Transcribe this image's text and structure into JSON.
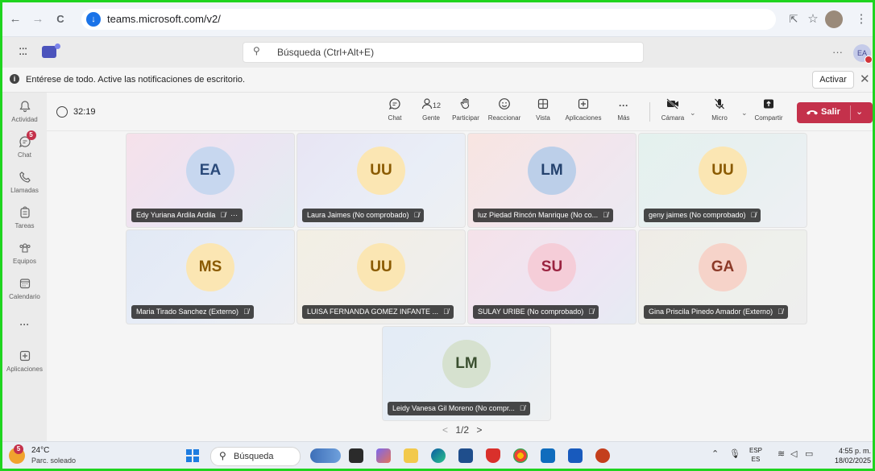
{
  "browser": {
    "url": "teams.microsoft.com/v2/",
    "back": "←",
    "forward": "→",
    "reload": "C",
    "cast": "⇱",
    "star": "☆",
    "menu": "⋮"
  },
  "teams_header": {
    "waffle": ":::",
    "search_placeholder": "Búsqueda (Ctrl+Alt+E)",
    "search_icon": "⚲",
    "more": "···",
    "user_initials": "EA"
  },
  "notification": {
    "message": "Entérese de todo. Active las notificaciones de escritorio.",
    "activate_label": "Activar",
    "close": "✕"
  },
  "rail": [
    {
      "label": "Actividad",
      "icon": "bell-icon",
      "glyph": "♫",
      "badge": ""
    },
    {
      "label": "Chat",
      "icon": "chat-icon",
      "glyph": "☺",
      "badge": "5"
    },
    {
      "label": "Llamadas",
      "icon": "phone-icon",
      "glyph": "☏",
      "badge": ""
    },
    {
      "label": "Tareas",
      "icon": "tasks-icon",
      "glyph": "⌂",
      "badge": ""
    },
    {
      "label": "Equipos",
      "icon": "teams-icon",
      "glyph": "⁂",
      "badge": ""
    },
    {
      "label": "Calendario",
      "icon": "calendar-icon",
      "glyph": "▦",
      "badge": ""
    },
    {
      "label": "",
      "icon": "more-icon",
      "glyph": "···",
      "badge": ""
    },
    {
      "label": "Aplicaciones",
      "icon": "apps-icon",
      "glyph": "⊞",
      "badge": ""
    }
  ],
  "meeting": {
    "timer": "32:19",
    "people_count": "12",
    "controls": {
      "chat": "Chat",
      "people": "Gente",
      "raise": "Participar",
      "react": "Reaccionar",
      "view": "Vista",
      "apps": "Aplicaciones",
      "more": "Más",
      "camera": "Cámara",
      "mic": "Micro",
      "share": "Compartir",
      "leave": "Salir"
    },
    "participants": [
      {
        "initials": "EA",
        "name": "Edy Yuriana Ardila Ardila",
        "extra": "···"
      },
      {
        "initials": "UU",
        "name": "Laura Jaimes (No comprobado)",
        "extra": ""
      },
      {
        "initials": "LM",
        "name": "luz Piedad Rincón Manrique (No co...",
        "extra": ""
      },
      {
        "initials": "UU",
        "name": "geny jaimes (No comprobado)",
        "extra": ""
      },
      {
        "initials": "MS",
        "name": "Maria Tirado Sanchez (Externo)",
        "extra": ""
      },
      {
        "initials": "UU",
        "name": "LUISA FERNANDA GOMEZ INFANTE ...",
        "extra": ""
      },
      {
        "initials": "SU",
        "name": "SULAY URIBE (No comprobado)",
        "extra": ""
      },
      {
        "initials": "GA",
        "name": "Gina Priscila Pinedo Amador (Externo)",
        "extra": ""
      },
      {
        "initials": "LM",
        "name": "Leidy Vanesa Gil Moreno (No compr...",
        "extra": ""
      }
    ],
    "pager": {
      "prev": "<",
      "page": "1/2",
      "next": ">"
    }
  },
  "taskbar": {
    "weather_badge": "5",
    "temperature": "24°C",
    "condition": "Parc. soleado",
    "search": "Búsqueda",
    "lang_top": "ESP",
    "lang_bottom": "ES",
    "time": "4:55 p. m.",
    "date": "18/02/2025"
  }
}
